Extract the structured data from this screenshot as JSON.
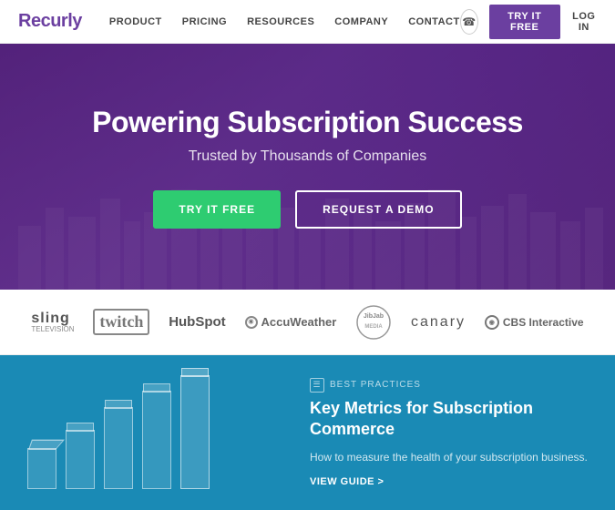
{
  "navbar": {
    "logo": "Recurly",
    "links": [
      "PRODUCT",
      "PRICING",
      "RESOURCES",
      "COMPANY",
      "CONTACT"
    ],
    "try_label": "TRY IT FREE",
    "login_label": "LOG IN"
  },
  "hero": {
    "title": "Powering Subscription Success",
    "subtitle": "Trusted by Thousands of Companies",
    "btn_try": "TRY IT FREE",
    "btn_demo": "REQUEST A DEMO"
  },
  "logos": {
    "items": [
      "sling",
      "twitch",
      "HubSpot",
      "AccuWeather",
      "jibjab",
      "canary",
      "CBS Interactive"
    ]
  },
  "feature": {
    "tag": "Best Practices",
    "title": "Key Metrics for Subscription Commerce",
    "desc": "How to measure the health of your subscription business.",
    "link": "VIEW GUIDE >"
  }
}
